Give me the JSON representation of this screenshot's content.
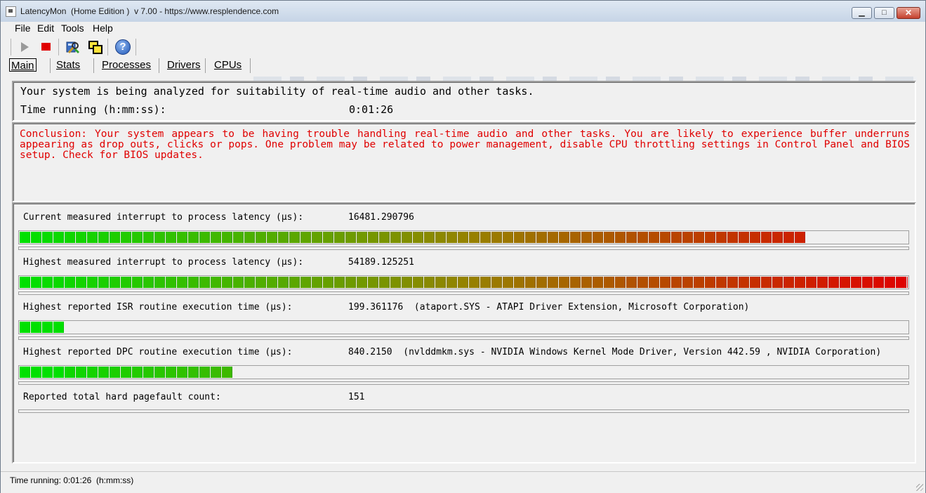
{
  "window": {
    "title": "LatencyMon  (Home Edition )  v 7.00 - https://www.resplendence.com",
    "min_glyph": "▁",
    "max_glyph": "□",
    "close_glyph": "✕"
  },
  "menu": [
    "File",
    "Edit",
    "Tools",
    "Help"
  ],
  "toolbar": {
    "play_icon": "play-icon",
    "stop_icon": "stop-icon",
    "analyze_icon": "analyze-icon",
    "windows_icon": "windows-icon",
    "help_icon": "help-icon",
    "help_glyph": "?"
  },
  "tabs": [
    "Main",
    "Stats",
    "Processes",
    "Drivers",
    "CPUs"
  ],
  "status": {
    "line1": "Your system is being analyzed for suitability of real-time audio and other tasks.",
    "time_label": "Time running (h:mm:ss):",
    "time_value": "0:01:26"
  },
  "conclusion": "Conclusion: Your system appears to be having trouble handling real-time audio and other tasks. You are likely to experience buffer underruns appearing as drop outs, clicks or pops. One problem may be related to power management, disable CPU throttling settings in Control Panel and BIOS setup. Check for BIOS updates.",
  "metrics": [
    {
      "label": "Current measured interrupt to process latency (µs):",
      "value": "16481.290796",
      "fill_fraction": 0.885,
      "gradient": true
    },
    {
      "label": "Highest measured interrupt to process latency (µs):",
      "value": "54189.125251",
      "fill_fraction": 1.0,
      "gradient": true
    },
    {
      "label": "Highest reported ISR routine execution time (µs):",
      "value": "199.361176  (ataport.SYS - ATAPI Driver Extension, Microsoft Corporation)",
      "fill_fraction": 0.05,
      "gradient": false
    },
    {
      "label": "Highest reported DPC routine execution time (µs):",
      "value": "840.2150  (nvlddmkm.sys - NVIDIA Windows Kernel Mode Driver, Version 442.59 , NVIDIA Corporation)",
      "fill_fraction": 0.24,
      "gradient": false
    },
    {
      "label": "Reported total hard pagefault count:",
      "value": "151",
      "fill_fraction": 0,
      "gradient": false
    }
  ],
  "statusbar": "Time running: 0:01:26  (h:mm:ss)",
  "colors": {
    "green": "#00e000",
    "red": "#e00000",
    "conclusion": "#e00000"
  }
}
